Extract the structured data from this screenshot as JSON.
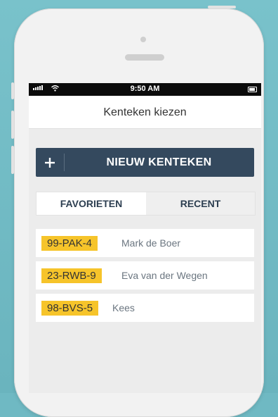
{
  "status_bar": {
    "time": "9:50 AM"
  },
  "nav": {
    "title": "Kenteken kiezen"
  },
  "new_plate_button": {
    "label": "NIEUW KENTEKEN"
  },
  "tabs": [
    {
      "label": "FAVORIETEN",
      "selected": true
    },
    {
      "label": "RECENT",
      "selected": false
    }
  ],
  "favorites": [
    {
      "plate": "99-PAK-4",
      "name": "Mark de Boer"
    },
    {
      "plate": "23-RWB-9",
      "name": "Eva van der Wegen"
    },
    {
      "plate": "98-BVS-5",
      "name": "Kees"
    }
  ],
  "colors": {
    "plate_bg": "#f6c42a",
    "button_bg": "#34495e",
    "background": "#6fb9c3"
  }
}
